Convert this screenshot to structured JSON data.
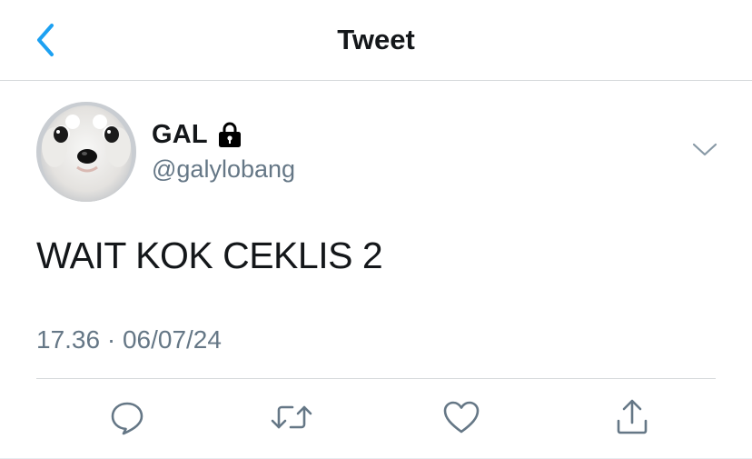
{
  "header": {
    "back_icon": "chevron-left-icon",
    "title": "Tweet",
    "accent_color": "#1da1f2"
  },
  "tweet": {
    "author": {
      "display_name": "GAL",
      "handle": "@galylobang",
      "protected_icon": "lock-icon",
      "avatar": "dog-avatar"
    },
    "menu_icon": "chevron-down-icon",
    "text": "WAIT KOK CEKLIS 2",
    "timestamp": "17.36 · 06/07/24"
  },
  "actions": [
    {
      "name": "reply",
      "icon": "comment-icon"
    },
    {
      "name": "retweet",
      "icon": "retweet-icon"
    },
    {
      "name": "like",
      "icon": "heart-icon"
    },
    {
      "name": "share",
      "icon": "share-icon"
    }
  ],
  "colors": {
    "text": "#14171a",
    "secondary_text": "#657786",
    "icon_gray": "#657786",
    "divider": "#d6d9dc"
  }
}
